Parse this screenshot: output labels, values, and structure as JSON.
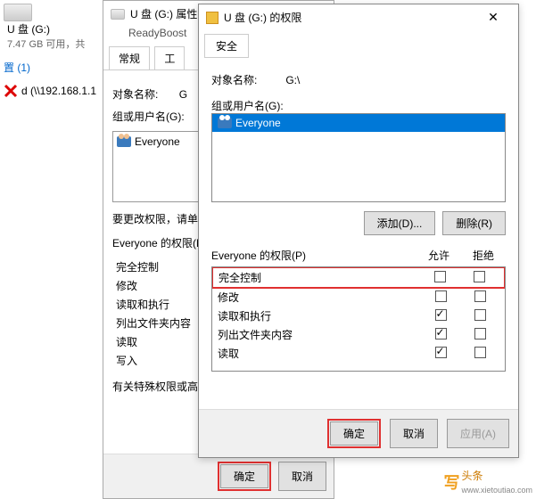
{
  "bg": {
    "drive_title": "U 盘 (G:)",
    "drive_sub": "7.47 GB 可用，共",
    "side_link": "置 (1)",
    "net_item": "d (\\\\192.168.1.1"
  },
  "props": {
    "title": "U 盘 (G:) 属性",
    "readyboost": "ReadyBoost",
    "tab_general": "常规",
    "tab_tools": "工",
    "obj_label": "对象名称:",
    "obj_value": "G",
    "group_label": "组或用户名(G):",
    "everyone": "Everyone",
    "change_text": "要更改权限，请单击",
    "perm_header": "Everyone 的权限(P)",
    "perms": [
      "完全控制",
      "修改",
      "读取和执行",
      "列出文件夹内容",
      "读取",
      "写入"
    ],
    "footer_note": "有关特殊权限或高级",
    "ok": "确定",
    "cancel": "取消"
  },
  "perm": {
    "title": "U 盘 (G:) 的权限",
    "tab_security": "安全",
    "obj_label": "对象名称:",
    "obj_value": "G:\\",
    "group_label": "组或用户名(G):",
    "everyone": "Everyone",
    "add_btn": "添加(D)...",
    "remove_btn": "删除(R)",
    "perm_header": "Everyone 的权限(P)",
    "col_allow": "允许",
    "col_deny": "拒绝",
    "rows": [
      {
        "name": "完全控制",
        "allow": false,
        "deny": false,
        "hl": true
      },
      {
        "name": "修改",
        "allow": false,
        "deny": false
      },
      {
        "name": "读取和执行",
        "allow": true,
        "deny": false
      },
      {
        "name": "列出文件夹内容",
        "allow": true,
        "deny": false
      },
      {
        "name": "读取",
        "allow": true,
        "deny": false
      }
    ],
    "ok": "确定",
    "cancel": "取消",
    "apply": "应用(A)"
  },
  "watermark": {
    "char": "写",
    "text": "头条",
    "url": "www.xietoutiao.com"
  }
}
